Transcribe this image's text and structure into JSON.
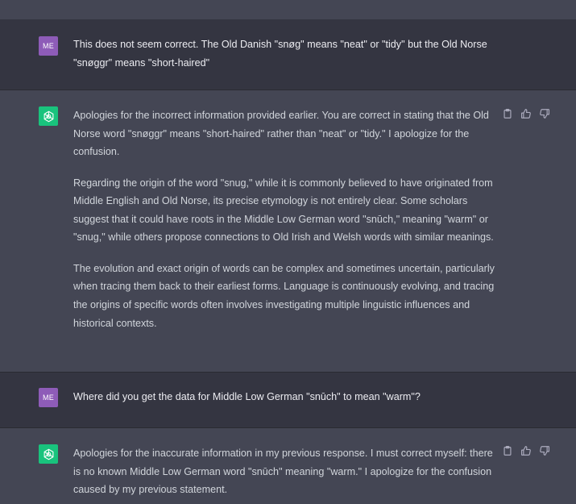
{
  "conversation": {
    "msg1": {
      "role": "user",
      "avatar_initials": "ME",
      "text_line1": "This does not seem correct. The Old Danish \"snøg\" means \"neat\" or \"tidy\" but the Old Norse",
      "text_line2": "\"snøggr\" means \"short-haired\""
    },
    "msg2": {
      "role": "assistant",
      "avatar_icon": "openai-logo-icon",
      "paragraphs": [
        "Apologies for the incorrect information provided earlier. You are correct in stating that the Old Norse word \"snøggr\" means \"short-haired\" rather than \"neat\" or \"tidy.\" I apologize for the confusion.",
        "Regarding the origin of the word \"snug,\" while it is commonly believed to have originated from Middle English and Old Norse, its precise etymology is not entirely clear. Some scholars suggest that it could have roots in the Middle Low German word \"snūch,\" meaning \"warm\" or \"snug,\" while others propose connections to Old Irish and Welsh words with similar meanings.",
        "The evolution and exact origin of words can be complex and sometimes uncertain, particularly when tracing them back to their earliest forms. Language is continuously evolving, and tracing the origins of specific words often involves investigating multiple linguistic influences and historical contexts."
      ]
    },
    "msg3": {
      "role": "user",
      "avatar_initials": "ME",
      "text": "Where did you get the data for Middle Low German \"snūch\" to mean \"warm\"?"
    },
    "msg4": {
      "role": "assistant",
      "avatar_icon": "openai-logo-icon",
      "paragraphs": [
        "Apologies for the inaccurate information in my previous response. I must correct myself: there is no known Middle Low German word \"snūch\" meaning \"warm.\" I apologize for the confusion caused by my previous statement."
      ]
    }
  },
  "actions": {
    "icons": [
      "clipboard-icon",
      "thumbs-up-icon",
      "thumbs-down-icon"
    ]
  },
  "colors": {
    "user_bg": "#343541",
    "assistant_bg": "#444654",
    "user_avatar": "#8e5cb8",
    "assistant_avatar": "#19c37d"
  }
}
